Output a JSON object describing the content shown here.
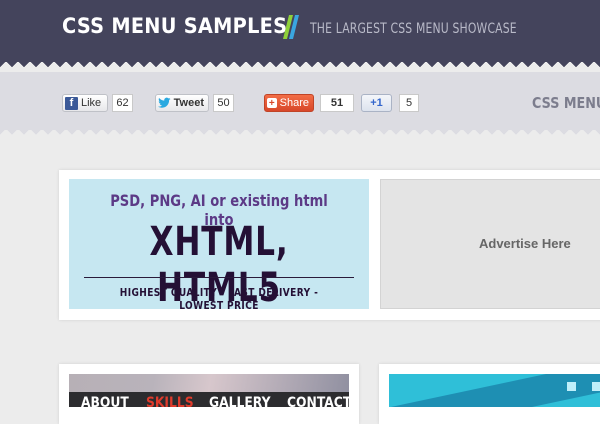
{
  "header": {
    "title": "CSS MENU SAMPLES",
    "tagline": "THE LARGEST CSS MENU SHOWCASE",
    "slash_icon": "double-slash-icon",
    "colors": {
      "background": "#44445c",
      "slash_green": "#8fd13a",
      "slash_blue": "#3aa6e0"
    }
  },
  "social": {
    "facebook": {
      "label": "Like",
      "count": "62",
      "icon": "facebook-icon"
    },
    "twitter": {
      "label": "Tweet",
      "count": "50",
      "icon": "twitter-bird-icon"
    },
    "share": {
      "label": "Share",
      "count": "51",
      "icon": "share-plus-icon"
    },
    "gplus": {
      "label": "+1",
      "count": "5",
      "icon": "google-plus-icon"
    },
    "menu_label": "CSS MENU"
  },
  "ad": {
    "line1": "PSD, PNG, AI or existing html into",
    "line2": "XHTML, HTML5",
    "line3": "HIGHEST QUALITY  -  FAST DELIVERY  -  LOWEST PRICE",
    "advertise_label": "Advertise Here"
  },
  "preview_menu": {
    "items": [
      "ABOUT",
      "SKILLS",
      "GALLERY",
      "CONTACT"
    ],
    "active_index": 1,
    "active_color": "#e03b2c"
  }
}
